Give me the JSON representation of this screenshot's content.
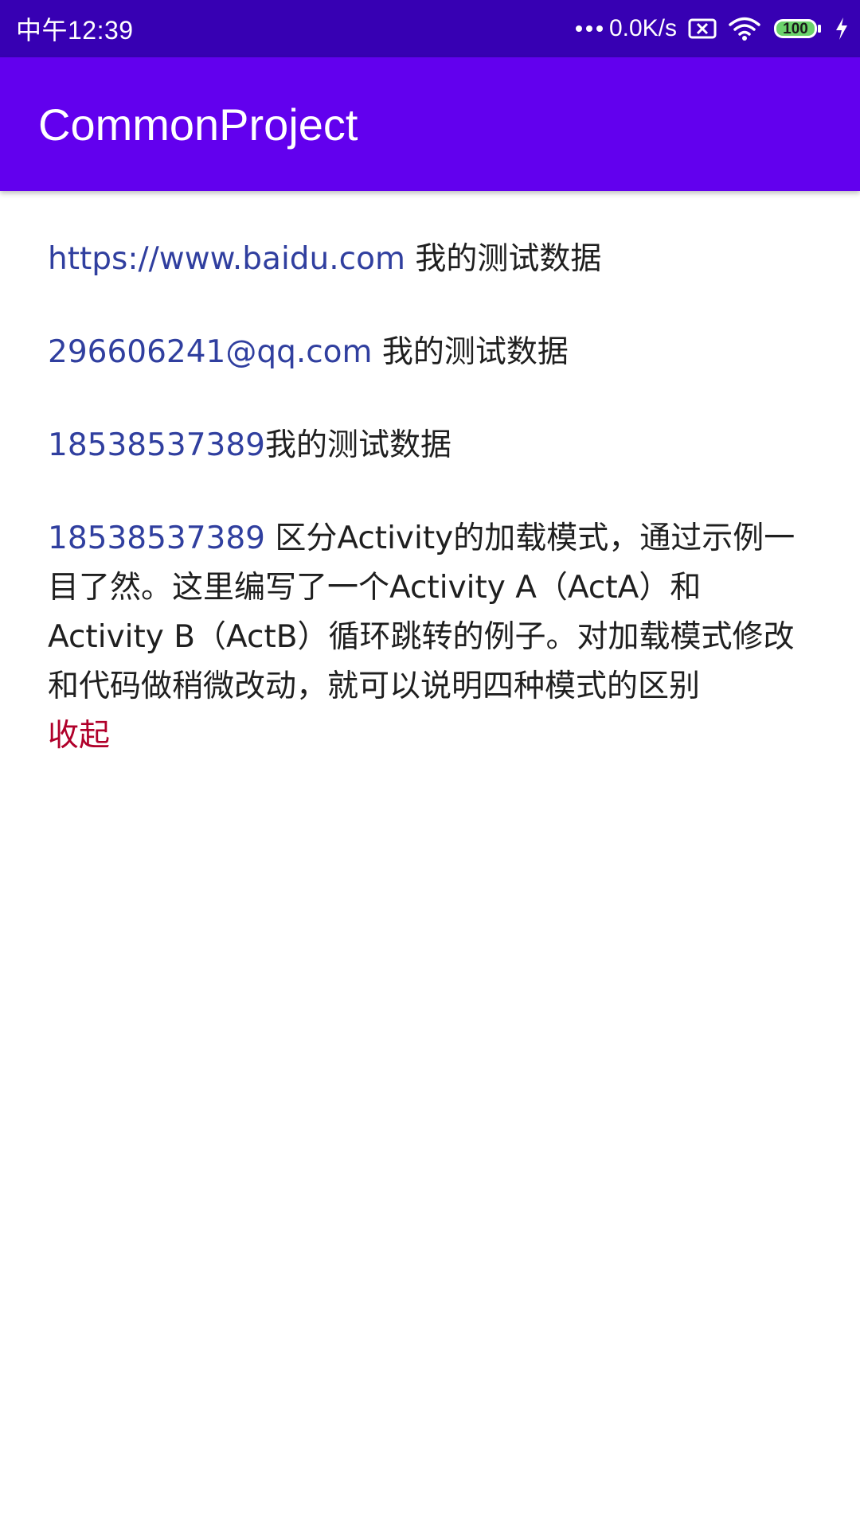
{
  "status_bar": {
    "time": "中午12:39",
    "net_speed": "0.0K/s",
    "battery": "100",
    "icons": [
      "more-dots-icon",
      "sim-card-missing-icon",
      "wifi-icon",
      "battery-icon",
      "charging-bolt-icon"
    ]
  },
  "app_bar": {
    "title": "CommonProject"
  },
  "items": [
    {
      "link": "https://www.baidu.com",
      "text": " 我的测试数据"
    },
    {
      "link": "296606241@qq.com",
      "text": " 我的测试数据"
    },
    {
      "link": "18538537389",
      "text": "我的测试数据"
    }
  ],
  "expandable": {
    "link": "18538537389",
    "text": " 区分Activity的加载模式，通过示例一目了然。这里编写了一个Activity A（ActA）和Activity B（ActB）循环跳转的例子。对加载模式修改和代码做稍微改动，就可以说明四种模式的区别",
    "toggle": "收起"
  },
  "colors": {
    "status_bar": "#3700b3",
    "app_bar": "#6200ee",
    "link": "#303f9f",
    "toggle": "#b0002a",
    "text": "#1f1f1f"
  }
}
